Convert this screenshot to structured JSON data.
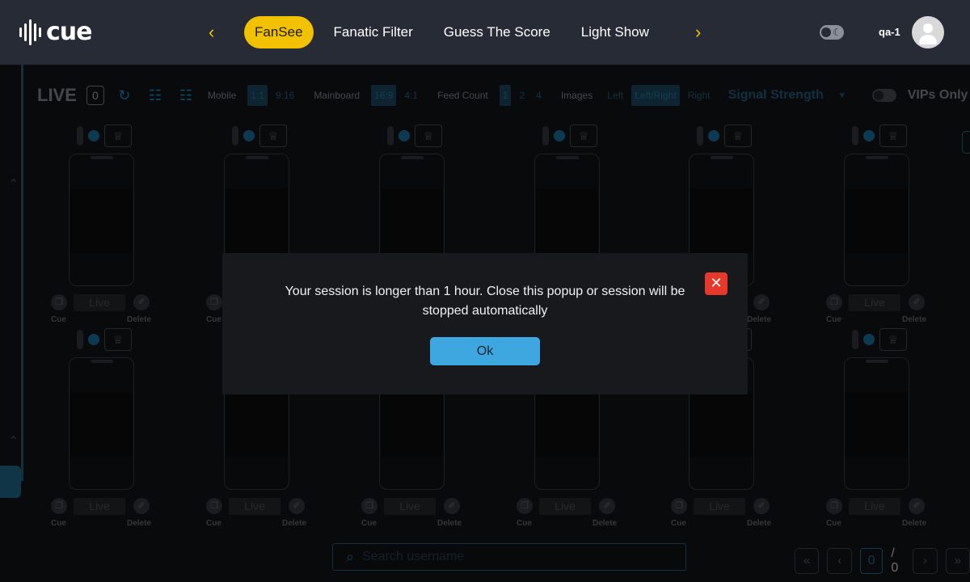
{
  "brand": {
    "name": "cue"
  },
  "nav": {
    "tabs": [
      {
        "label": "FanSee",
        "active": true
      },
      {
        "label": "Fanatic Filter",
        "active": false
      },
      {
        "label": "Guess The Score",
        "active": false
      },
      {
        "label": "Light Show",
        "active": false
      }
    ],
    "prev_icon": "chevron-left-icon",
    "next_icon": "chevron-right-icon"
  },
  "user": {
    "name": "qa-1"
  },
  "colors": {
    "accent": "#f2c200",
    "primary": "#3fa7df",
    "danger": "#e6392c",
    "topbar": "#262b36"
  },
  "controls": {
    "live_title": "LIVE",
    "live_count": "0",
    "mobile_label": "Mobile",
    "mobile_options": [
      "1:1",
      "9:16"
    ],
    "mobile_selected": "1:1",
    "mainboard_label": "Mainboard",
    "mainboard_options": [
      "16:9",
      "4:1"
    ],
    "mainboard_selected": "16:9",
    "feed_count_label": "Feed Count",
    "feed_count_options": [
      "1",
      "2",
      "4"
    ],
    "feed_count_selected": "1",
    "images_label": "Images",
    "images_options": [
      "Left",
      "Left/Right",
      "Right"
    ],
    "images_selected": "Left/Right",
    "sort_select": "Signal Strength",
    "vip_label": "VIPs Only"
  },
  "feed_cell": {
    "live_label": "Live",
    "cue_label": "Cue",
    "delete_label": "Delete"
  },
  "search": {
    "placeholder": "Search username"
  },
  "pagination": {
    "current": "0",
    "total": "/ 0"
  },
  "modal": {
    "message": "Your session is longer than 1 hour. Close this popup or session will be stopped automatically",
    "ok_label": "Ok"
  }
}
